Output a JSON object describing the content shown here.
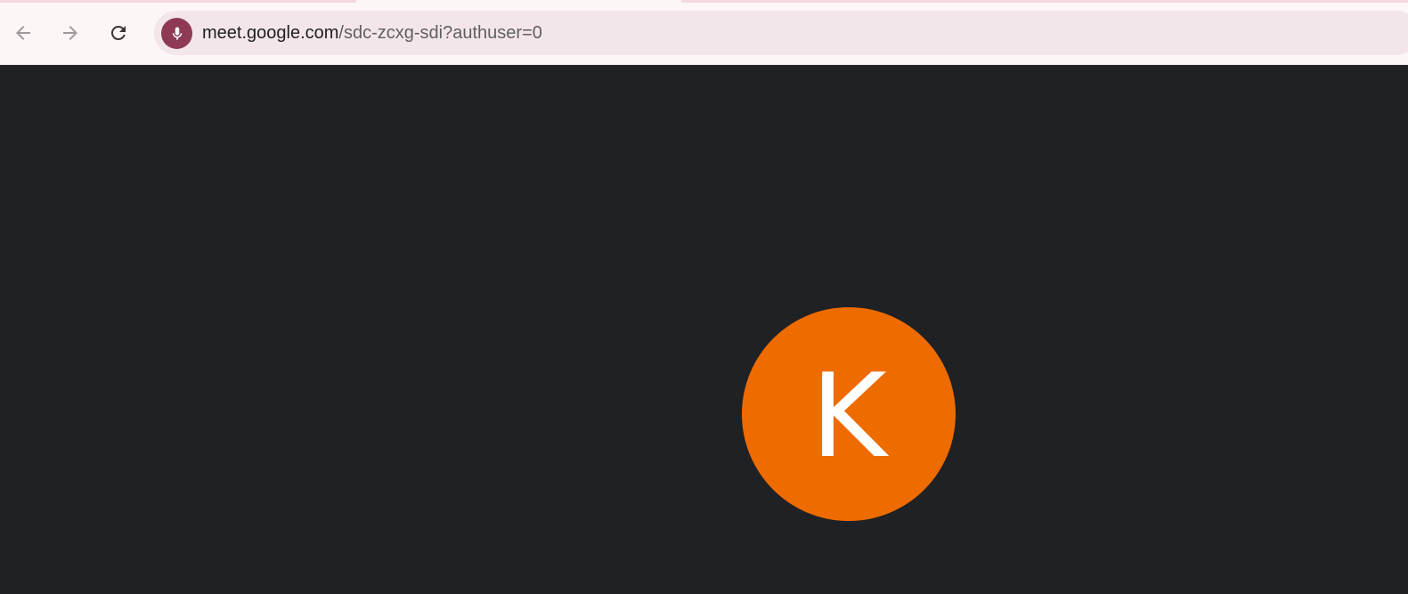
{
  "browser": {
    "url_host": "meet.google.com",
    "url_path": "/sdc-zcxg-sdi?authuser=0",
    "icons": {
      "back": "arrow-left-icon",
      "forward": "arrow-right-icon",
      "reload": "reload-icon",
      "site_status": "microphone-icon"
    },
    "colors": {
      "toolbar_bg": "#fdf6f7",
      "omnibox_bg": "#f3e6ea",
      "mic_badge": "#8e3a55"
    }
  },
  "meeting": {
    "participant_initial": "K",
    "colors": {
      "stage_bg": "#202124",
      "avatar_bg": "#ee6b00"
    }
  }
}
